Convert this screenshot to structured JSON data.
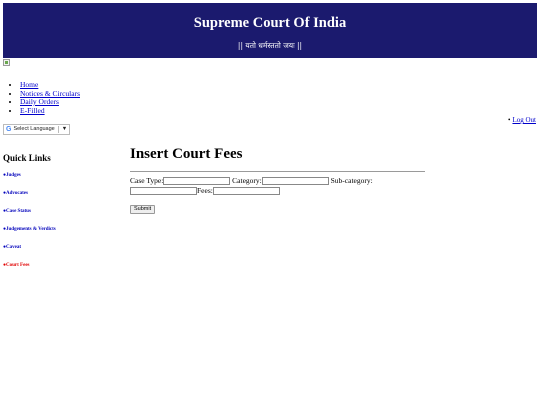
{
  "banner": {
    "title": "Supreme Court Of India",
    "motto": "|| यतो धर्मस्ततो जयः ||"
  },
  "topnav": {
    "items": [
      "Home",
      "Notices & Circulars",
      "Daily Orders",
      "E-Filled"
    ]
  },
  "language": {
    "label": "Select Language",
    "arrow": "▼"
  },
  "logout": {
    "label": "Log Out"
  },
  "quick_links": {
    "title": "Quick Links",
    "items": [
      "Judges",
      "Advocates",
      "Case Status",
      "Judgements & Verdicts",
      "Caveat",
      "Court Fees"
    ],
    "active": "Court Fees"
  },
  "main": {
    "title": "Insert Court Fees",
    "labels": {
      "case_type": "Case Type:",
      "category": "Category:",
      "sub_category": "Sub-category:",
      "fees": "Fees:"
    },
    "values": {
      "case_type": "",
      "category": "",
      "sub_category": "",
      "fees": ""
    },
    "submit_label": "Submit"
  },
  "colors": {
    "banner_bg": "#1b1a6e",
    "link": "#0000cc",
    "active_link": "#e00000"
  }
}
